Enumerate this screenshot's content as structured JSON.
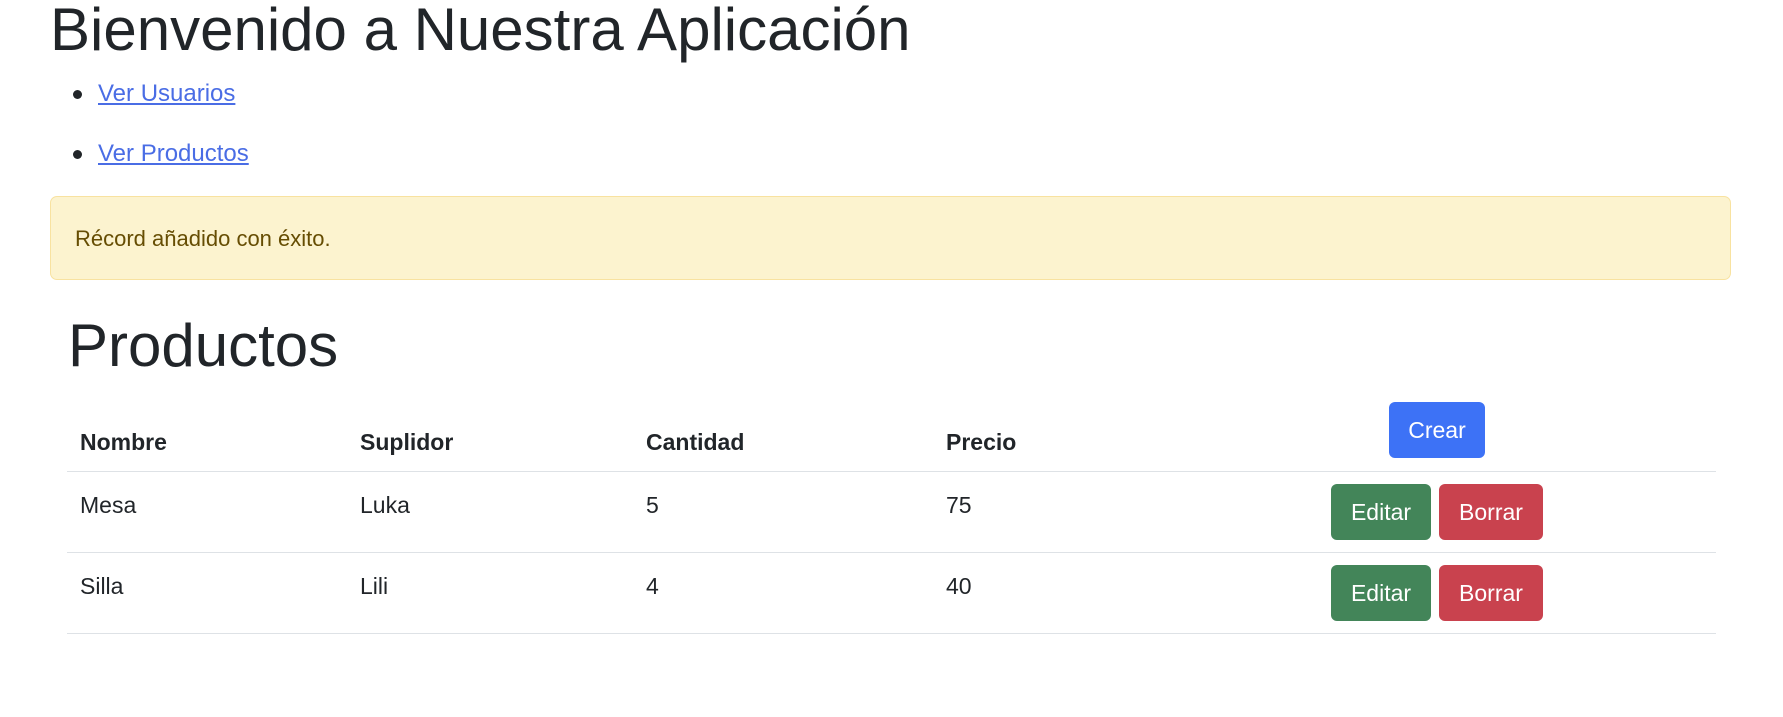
{
  "page": {
    "title": "Bienvenido a Nuestra Aplicación"
  },
  "nav": {
    "links": [
      {
        "label": "Ver Usuarios"
      },
      {
        "label": "Ver Productos"
      }
    ]
  },
  "alert": {
    "message": "Récord añadido con éxito."
  },
  "products": {
    "title": "Productos",
    "columns": [
      "Nombre",
      "Suplidor",
      "Cantidad",
      "Precio"
    ],
    "create_label": "Crear",
    "edit_label": "Editar",
    "delete_label": "Borrar",
    "rows": [
      {
        "nombre": "Mesa",
        "suplidor": "Luka",
        "cantidad": "5",
        "precio": "75"
      },
      {
        "nombre": "Silla",
        "suplidor": "Lili",
        "cantidad": "4",
        "precio": "40"
      }
    ]
  },
  "colors": {
    "primary": "#3d72f6",
    "success": "#438559",
    "danger": "#c9424e",
    "alert_bg": "#fcf3cf",
    "link": "#4a6de5"
  }
}
